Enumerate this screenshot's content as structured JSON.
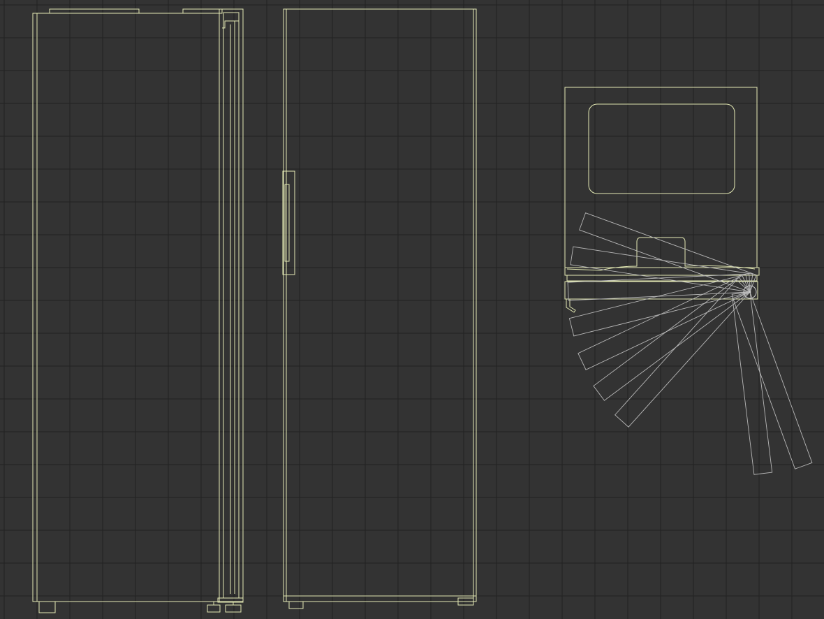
{
  "colors": {
    "background": "#333333",
    "grid": "#252525",
    "outline": "#e4eab4",
    "swing_arc": "#b8b8b8",
    "hinge": "#cfcfcf"
  },
  "grid": {
    "visible": true,
    "rows": 19,
    "cols": 25
  },
  "views": [
    {
      "id": "side-view",
      "name": "side-elevation"
    },
    {
      "id": "front-view",
      "name": "front-elevation"
    },
    {
      "id": "plan-view",
      "name": "plan-door-swing"
    }
  ],
  "door_swing": {
    "angles_deg": [
      0,
      15,
      30,
      45,
      60,
      75,
      90
    ]
  }
}
